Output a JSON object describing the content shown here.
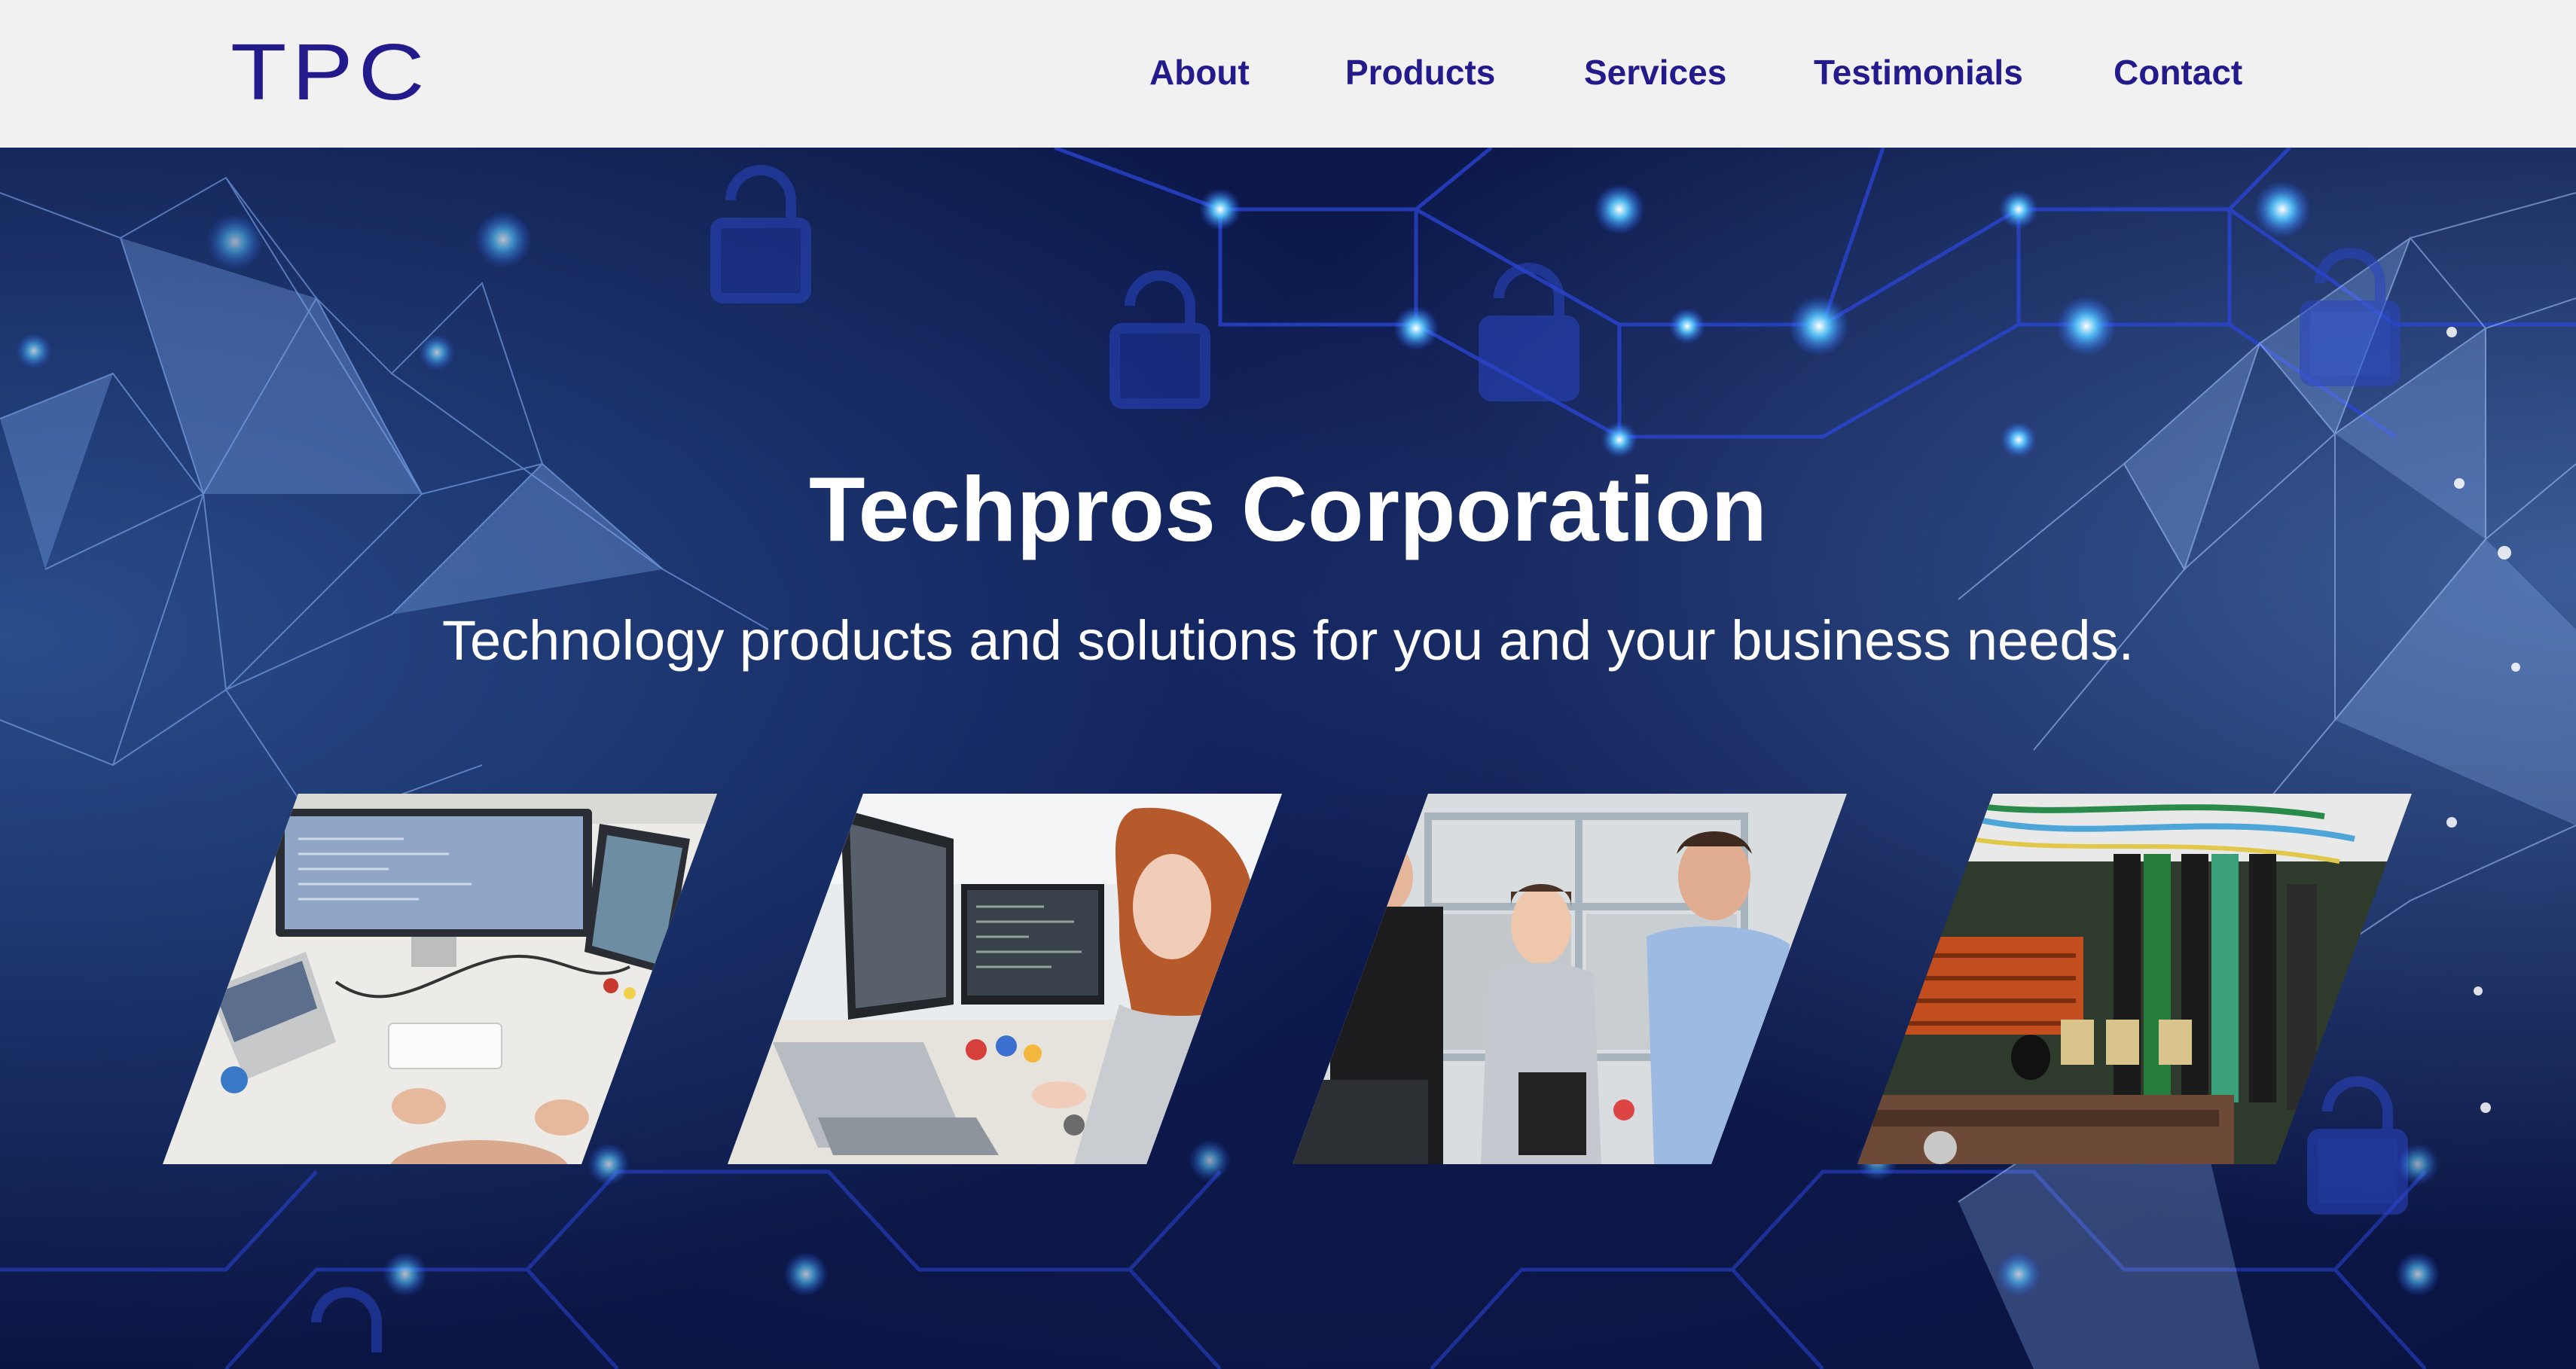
{
  "header": {
    "logo": "TPC",
    "nav": [
      {
        "label": "About"
      },
      {
        "label": "Products"
      },
      {
        "label": "Services"
      },
      {
        "label": "Testimonials"
      },
      {
        "label": "Contact"
      }
    ]
  },
  "hero": {
    "title": "Techpros Corporation",
    "subtitle": "Technology products and solutions for you and your business needs.",
    "images": [
      {
        "name": "developer-desk-photo"
      },
      {
        "name": "woman-at-computer-photo"
      },
      {
        "name": "lab-team-photo"
      },
      {
        "name": "circuit-board-photo"
      }
    ]
  },
  "colors": {
    "brand": "#231a8c",
    "header_bg": "#f1f1f1",
    "hero_bg": "#0c1848",
    "hero_text": "#ffffff"
  }
}
